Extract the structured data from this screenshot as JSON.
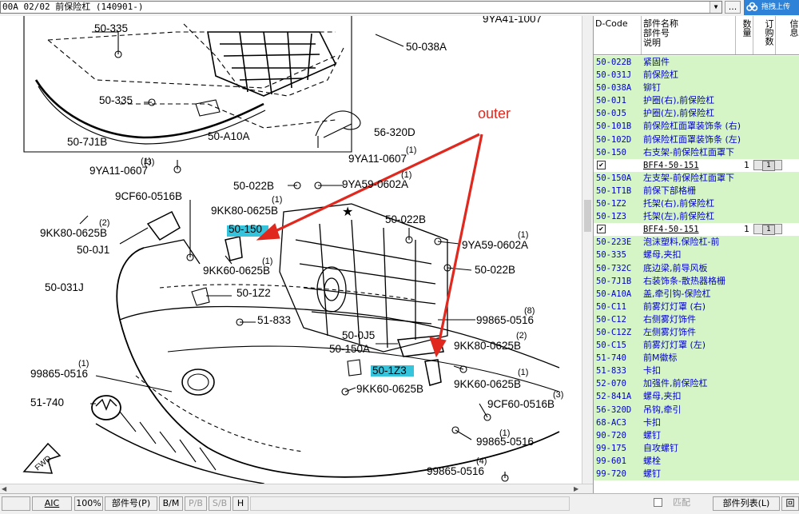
{
  "topbar": {
    "selector_value": "00A 02/02 前保险杠 (140901-)",
    "more_label": "...",
    "upload_label": "拖拽上传"
  },
  "diagram": {
    "annotation": "outer",
    "star": "★",
    "fwd": "FWD",
    "labels": [
      "50-335",
      "50-335",
      "50-038A",
      "9YA41-1007",
      "50-7J1B",
      "50-A10A",
      "56-320D",
      "9YA11-0607",
      "9YA11-0607",
      "50-022B",
      "9YA59-0602A",
      "9CF60-0516B",
      "9KK80-0625B",
      "9KK80-0625B",
      "50-0J1",
      "50-150",
      "9KK60-0625B",
      "50-1Z2",
      "50-031J",
      "51-833",
      "50-022B",
      "9YA59-0602A",
      "50-022B",
      "99865-0516",
      "50-0J5",
      "50-150A",
      "9KK80-0625B",
      "50-1Z3",
      "9KK60-0625B",
      "9KK60-0625B",
      "99865-0516",
      "51-740",
      "9CF60-0516B",
      "99865-0516",
      "99865-0516"
    ],
    "qty_marks": [
      "(1)",
      "(1)",
      "(1)",
      "(1)",
      "(2)",
      "(1)",
      "(1)",
      "(1)",
      "(8)",
      "(2)",
      "(1)",
      "(3)",
      "(1)",
      "(4)",
      "(3)"
    ]
  },
  "panel": {
    "headers": {
      "dcode": "D-Code",
      "name": "部件名称\n部件号\n说明",
      "qty": "数量",
      "order": "订购数",
      "info": "信息"
    },
    "rows": [
      {
        "type": "part",
        "code": "50-022B",
        "name": "紧固件"
      },
      {
        "type": "part",
        "code": "50-031J",
        "name": "前保险杠"
      },
      {
        "type": "part",
        "code": "50-038A",
        "name": "铆钉"
      },
      {
        "type": "part",
        "code": "50-0J1",
        "name": "护圈(右),前保险杠"
      },
      {
        "type": "part",
        "code": "50-0J5",
        "name": "护圈(左),前保险杠"
      },
      {
        "type": "part",
        "code": "50-101B",
        "name": "前保险杠面罩装饰条 (右)"
      },
      {
        "type": "part",
        "code": "50-102D",
        "name": "前保险杠面罩装饰条 (左)"
      },
      {
        "type": "part",
        "code": "50-150",
        "name": "右支架-前保险杠面罩下"
      },
      {
        "type": "sub",
        "check": "✔",
        "code": "BFF4-50-151",
        "qty": "1",
        "order": "1"
      },
      {
        "type": "part",
        "code": "50-150A",
        "name": "左支架-前保险杠面罩下"
      },
      {
        "type": "part",
        "code": "50-1T1B",
        "name": "前保下部格栅"
      },
      {
        "type": "part",
        "code": "50-1Z2",
        "name": "托架(右),前保险杠"
      },
      {
        "type": "part",
        "code": "50-1Z3",
        "name": "托架(左),前保险杠"
      },
      {
        "type": "sub",
        "check": "✔",
        "code": "BFF4-50-151",
        "qty": "1",
        "order": "1"
      },
      {
        "type": "part",
        "code": "50-223E",
        "name": "泡沫塑料,保险杠-前"
      },
      {
        "type": "part",
        "code": "50-335",
        "name": "螺母,夹扣"
      },
      {
        "type": "part",
        "code": "50-732C",
        "name": "底边梁,前导风板"
      },
      {
        "type": "part",
        "code": "50-7J1B",
        "name": "右装饰条-散热器格栅"
      },
      {
        "type": "part",
        "code": "50-A10A",
        "name": "盖,牵引钩-保险杠"
      },
      {
        "type": "part",
        "code": "50-C11",
        "name": "前雾灯灯罩 (右)"
      },
      {
        "type": "part",
        "code": "50-C12",
        "name": "右侧雾灯饰件"
      },
      {
        "type": "part",
        "code": "50-C12Z",
        "name": "左侧雾灯饰件"
      },
      {
        "type": "part",
        "code": "50-C15",
        "name": "前雾灯灯罩 (左)"
      },
      {
        "type": "part",
        "code": "51-740",
        "name": "前M徽标"
      },
      {
        "type": "part",
        "code": "51-833",
        "name": "卡扣"
      },
      {
        "type": "part",
        "code": "52-070",
        "name": "加强件,前保险杠"
      },
      {
        "type": "part",
        "code": "52-841A",
        "name": "螺母,夹扣"
      },
      {
        "type": "part",
        "code": "56-320D",
        "name": "吊钩,牵引"
      },
      {
        "type": "part",
        "code": "68-AC3",
        "name": "卡扣"
      },
      {
        "type": "part",
        "code": "90-720",
        "name": "螺钉"
      },
      {
        "type": "part",
        "code": "99-175",
        "name": "自攻螺钉"
      },
      {
        "type": "part",
        "code": "99-601",
        "name": "螺栓"
      },
      {
        "type": "part",
        "code": "99-720",
        "name": "螺钉"
      }
    ]
  },
  "statusbar": {
    "aic": "AIC",
    "zoom": "100%",
    "partno": "部件号(P)",
    "bm": "B/M",
    "pb": "P/B",
    "sb": "S/B",
    "h": "H",
    "match": "匹配",
    "partlist": "部件列表(L)",
    "back": "回"
  },
  "colors": {
    "part_row_bg": "#d6f5c6",
    "link_text": "#0000cc",
    "annotation": "#e0281e",
    "highlight": "#36c4dc",
    "upload_btn": "#2e83d8"
  }
}
